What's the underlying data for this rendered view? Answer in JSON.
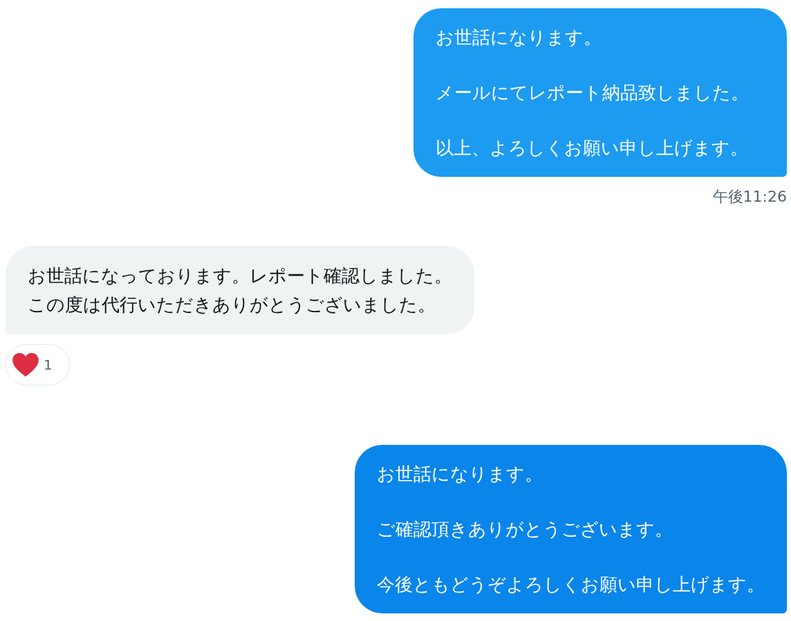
{
  "messages": [
    {
      "kind": "sent",
      "color": "#1d9bf0",
      "paragraphs": [
        "お世話になります。",
        "メールにてレポート納品致しました。",
        "以上、よろしくお願い申し上げます。"
      ],
      "time": "午後11:26"
    },
    {
      "kind": "received",
      "color": "#eff3f4",
      "paragraphs": [
        "お世話になっております。レポート確認しました。",
        "この度は代行いただきありがとうございました。"
      ],
      "reaction": {
        "count": "1"
      }
    },
    {
      "kind": "sent",
      "color": "#0a85ea",
      "paragraphs": [
        "お世話になります。",
        "ご確認頂きありがとうございます。",
        "今後ともどうぞよろしくお願い申し上げます。"
      ]
    }
  ]
}
